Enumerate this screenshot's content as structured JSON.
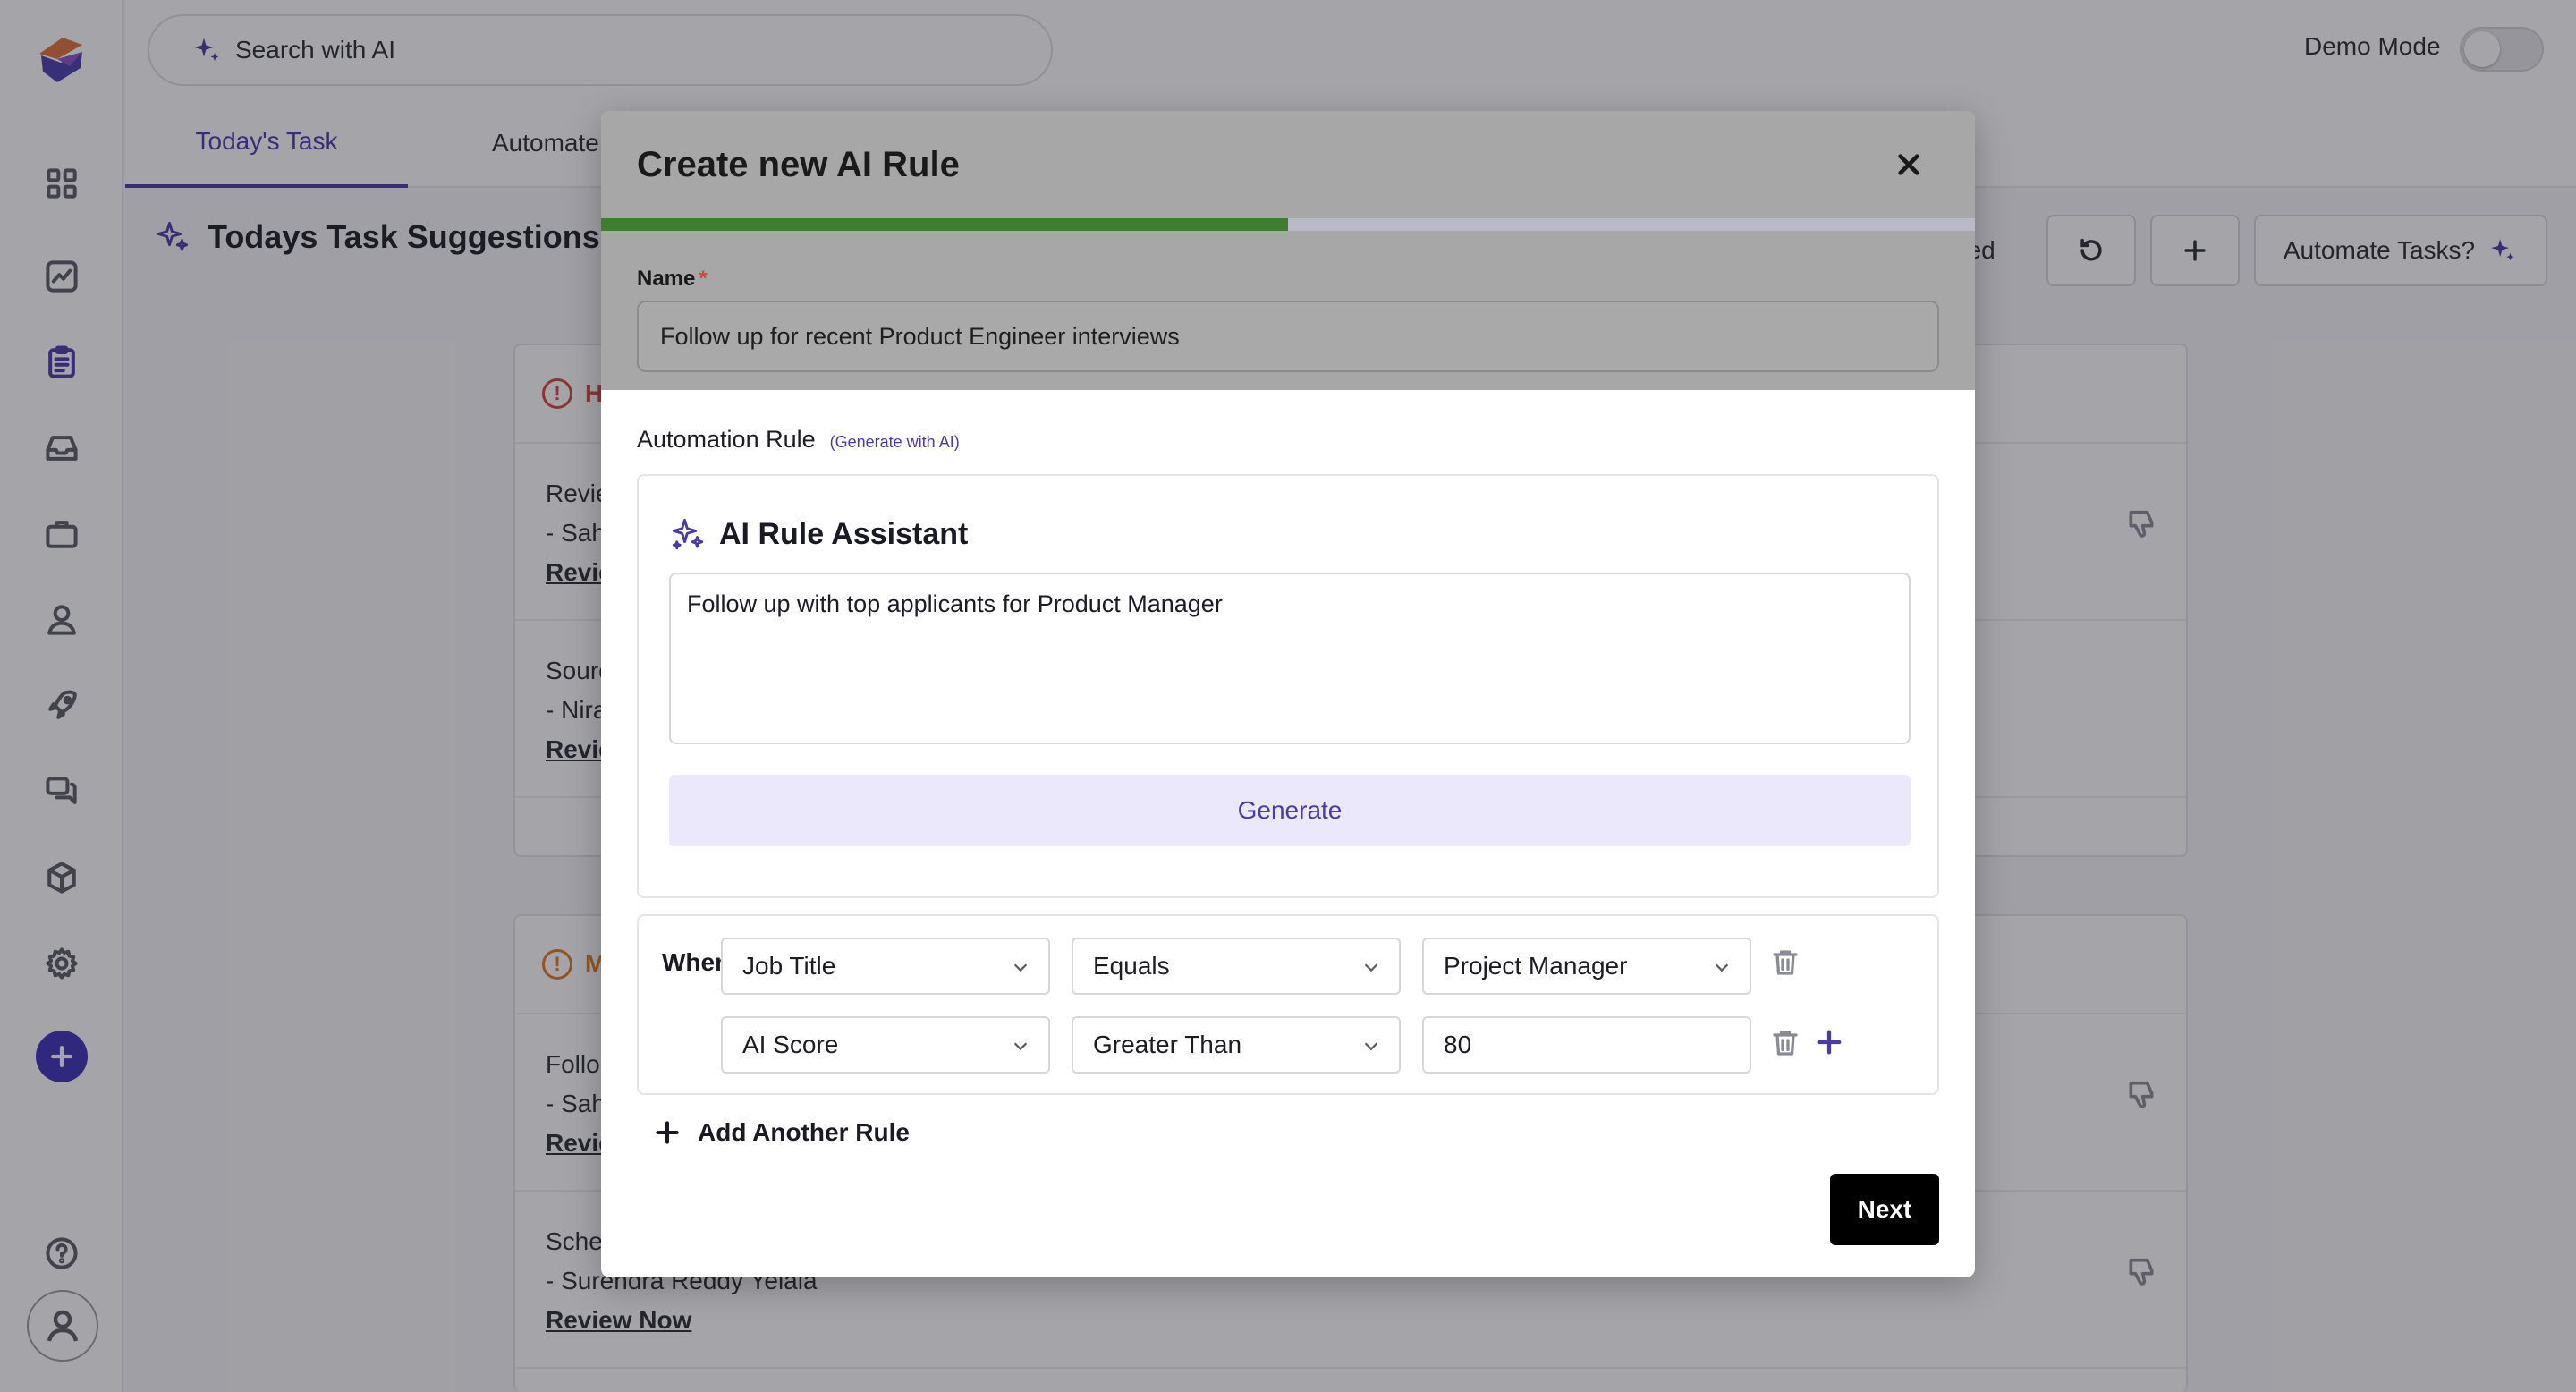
{
  "topbar": {
    "search_label": "Search with AI",
    "demo_mode_label": "Demo Mode",
    "demo_mode_on": false
  },
  "tabs": [
    {
      "label": "Today's Task",
      "active": true
    },
    {
      "label": "Automate",
      "active": false
    }
  ],
  "page": {
    "section_title": "Todays Task Suggestions",
    "completed_fragment": "leted",
    "automate_tasks_label": "Automate Tasks?"
  },
  "cards": [
    {
      "head_fragment": "H",
      "head_color": "#d9453a",
      "rows": [
        {
          "line1": "Revie",
          "line2": "- Sah",
          "link": "Revie"
        },
        {
          "line1": "Sourc",
          "line2": "- Nira",
          "link": "Revie"
        }
      ]
    },
    {
      "head_fragment": "M",
      "head_color": "#e07b1f",
      "rows": [
        {
          "line1": "Follo",
          "line2": "- Sah",
          "link": "Revie"
        },
        {
          "line1": "Sche",
          "line2": "- Surendra Reddy Yelala",
          "link": "Review Now"
        }
      ]
    }
  ],
  "modal": {
    "title": "Create new AI Rule",
    "progress": 0.5,
    "name_label": "Name",
    "name_required_mark": "*",
    "name_value": "Follow up for recent Product Engineer interviews",
    "automation_rule_label": "Automation Rule",
    "generate_with_ai_link": "(Generate with AI)",
    "assistant": {
      "title": "AI Rule Assistant",
      "prompt": "Follow up with top applicants for Product Manager",
      "generate_label": "Generate"
    },
    "conditions": {
      "when_label": "When the",
      "rows": [
        {
          "field": "Job Title",
          "operator": "Equals",
          "value": "Project Manager",
          "value_is_select": true
        },
        {
          "field": "AI Score",
          "operator": "Greater Than",
          "value": "80",
          "value_is_select": false
        }
      ]
    },
    "add_rule_label": "Add Another Rule",
    "next_label": "Next"
  },
  "colors": {
    "accent": "#4b3aa8",
    "progress": "#3f7d31",
    "next_button": "#000000"
  }
}
